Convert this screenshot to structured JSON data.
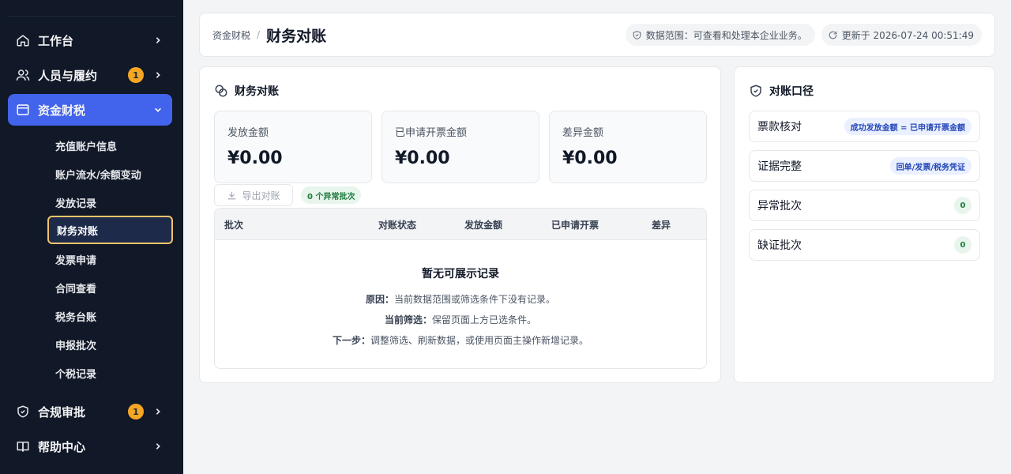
{
  "sidebar": {
    "items": [
      {
        "label": "工作台",
        "icon": "home-icon"
      },
      {
        "label": "人员与履约",
        "icon": "users-icon",
        "badge": "1"
      },
      {
        "label": "资金财税",
        "icon": "wallet-icon"
      },
      {
        "label": "合规审批",
        "icon": "shield-icon",
        "badge": "1"
      },
      {
        "label": "帮助中心",
        "icon": "book-icon"
      }
    ],
    "sub_items": [
      "充值账户信息",
      "账户流水/余额变动",
      "发放记录",
      "财务对账",
      "发票申请",
      "合同查看",
      "税务台账",
      "申报批次",
      "个税记录"
    ]
  },
  "header": {
    "breadcrumb_parent": "资金财税",
    "breadcrumb_sep": "/",
    "title": "财务对账",
    "scope": "数据范围：可查看和处理本企业业务。",
    "updated": "更新于 2026-07-24 00:51:49"
  },
  "main": {
    "title": "财务对账",
    "stats": [
      {
        "label": "发放金额",
        "value": "¥0.00"
      },
      {
        "label": "已申请开票金额",
        "value": "¥0.00"
      },
      {
        "label": "差异金额",
        "value": "¥0.00"
      }
    ],
    "export_label": "导出对账",
    "anomaly_count": "0 个异常批次",
    "columns": [
      "批次",
      "对账状态",
      "发放金额",
      "已申请开票",
      "差异"
    ],
    "empty": {
      "title": "暂无可展示记录",
      "reason_label": "原因：",
      "reason": "当前数据范围或筛选条件下没有记录。",
      "filter_label": "当前筛选：",
      "filter": "保留页面上方已选条件。",
      "next_label": "下一步：",
      "next": "调整筛选、刷新数据，或使用页面主操作新增记录。"
    }
  },
  "side": {
    "title": "对账口径",
    "rules": [
      {
        "label": "票款核对",
        "tag": "成功发放金额 = 已申请开票金额"
      },
      {
        "label": "证据完整",
        "tag": "回单/发票/税务凭证"
      },
      {
        "label": "异常批次",
        "count": "0"
      },
      {
        "label": "缺证批次",
        "count": "0"
      }
    ]
  },
  "colors": {
    "sidebar_bg": "#111827",
    "active_nav": "#4263eb",
    "active_sub_border": "#f0c46b",
    "badge": "#f5a623"
  }
}
